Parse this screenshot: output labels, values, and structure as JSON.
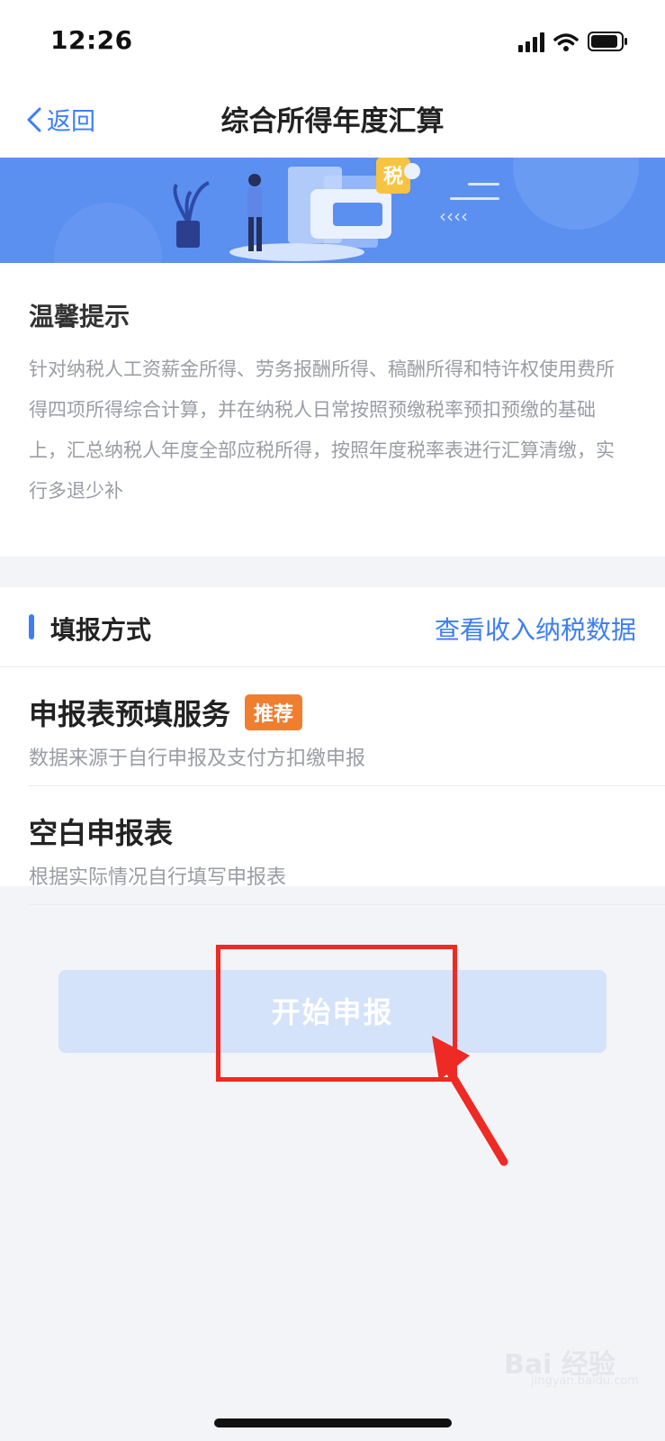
{
  "status_bar": {
    "time": "12:26"
  },
  "nav": {
    "back_label": "返回",
    "title": "综合所得年度汇算"
  },
  "banner": {
    "tax_char": "税"
  },
  "tips": {
    "title": "温馨提示",
    "body": "针对纳税人工资薪金所得、劳务报酬所得、稿酬所得和特许权使用费所得四项所得综合计算，并在纳税人日常按照预缴税率预扣预缴的基础上，汇总纳税人年度全部应税所得，按照年度税率表进行汇算清缴，实行多退少补"
  },
  "method": {
    "label": "填报方式",
    "view_data_link": "查看收入纳税数据",
    "options": [
      {
        "title": "申报表预填服务",
        "badge": "推荐",
        "subtitle": "数据来源于自行申报及支付方扣缴申报"
      },
      {
        "title": "空白申报表",
        "subtitle": "根据实际情况自行填写申报表"
      }
    ]
  },
  "start_button": {
    "label": "开始申报"
  },
  "watermark": {
    "text": "Bai 经验",
    "sub": "jingyan.baidu.com"
  },
  "colors": {
    "accent": "#3d7ef5",
    "badge": "#f07e2f",
    "annotation": "#ee2a24"
  }
}
